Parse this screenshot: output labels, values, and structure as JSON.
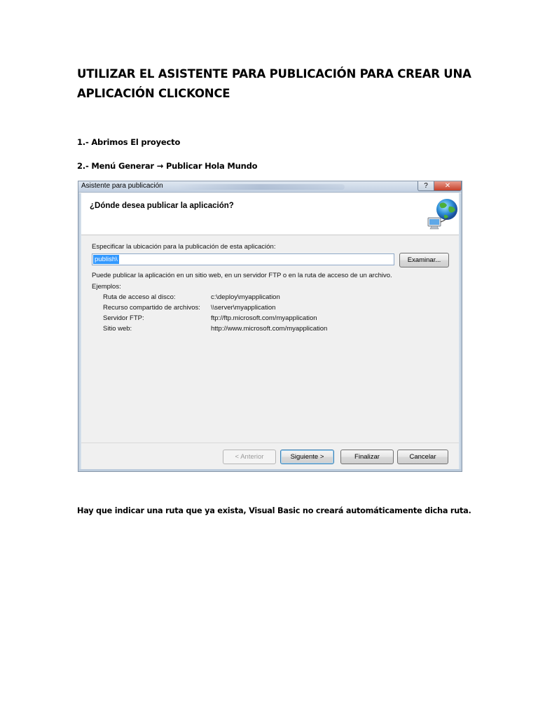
{
  "document": {
    "title": "UTILIZAR EL ASISTENTE PARA PUBLICACIÓN PARA CREAR UNA APLICACIÓN CLICKONCE",
    "step1": "1.- Abrimos El proyecto",
    "step2": "2.- Menú Generar → Publicar Hola Mundo",
    "note": "Hay que indicar una ruta que ya exista, Visual Basic no creará automáticamente dicha ruta."
  },
  "dialog": {
    "window_title": "Asistente para publicación",
    "help_button": "?",
    "close_button": "✕",
    "heading": "¿Dónde desea publicar la aplicación?",
    "location_label": "Especificar la ubicación para la publicación de esta aplicación:",
    "location_value": "publish\\",
    "browse_button": "Examinar...",
    "info_text": "Puede publicar la aplicación en un sitio web, en un servidor FTP o en la ruta de acceso de un archivo.",
    "examples_label": "Ejemplos:",
    "examples": [
      {
        "label": "Ruta de acceso al disco:",
        "value": "c:\\deploy\\myapplication"
      },
      {
        "label": "Recurso compartido de archivos:",
        "value": "\\\\server\\myapplication"
      },
      {
        "label": "Servidor FTP:",
        "value": "ftp://ftp.microsoft.com/myapplication"
      },
      {
        "label": "Sitio web:",
        "value": "http://www.microsoft.com/myapplication"
      }
    ],
    "buttons": {
      "previous": "< Anterior",
      "next": "Siguiente >",
      "finish": "Finalizar",
      "cancel": "Cancelar"
    },
    "icon": "globe-network-icon"
  }
}
